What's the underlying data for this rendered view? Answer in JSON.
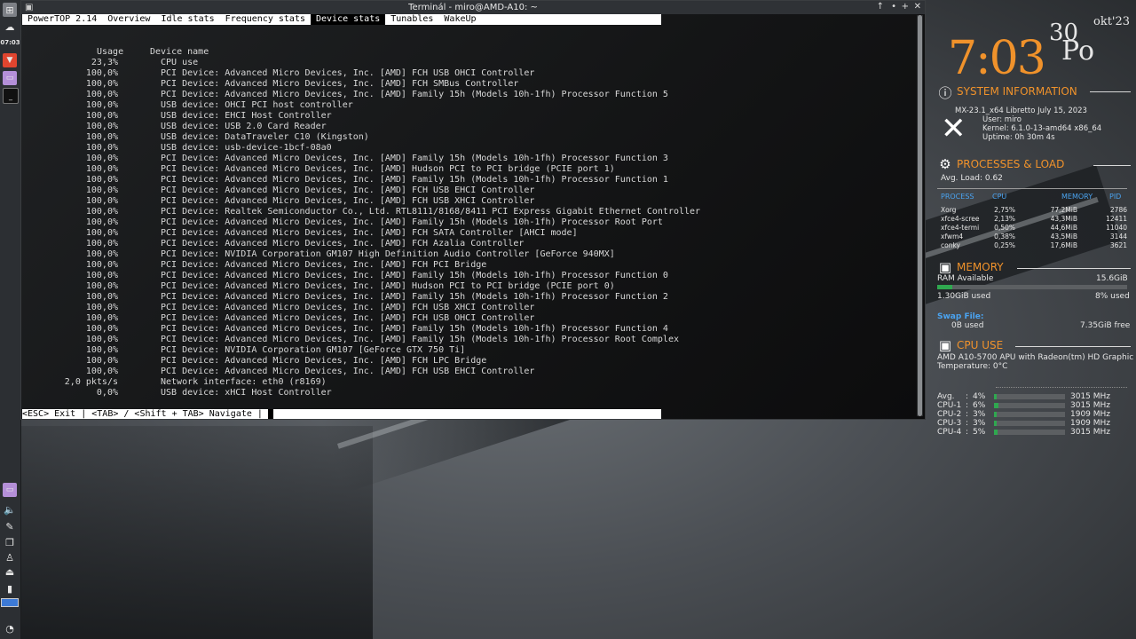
{
  "panel": {
    "clock": "07:03"
  },
  "window": {
    "title": "Terminál - miro@AMD-A10: ~"
  },
  "powertop": {
    "tabs": [
      {
        "label": "PowerTOP 2.14",
        "selected": false
      },
      {
        "label": "Overview",
        "selected": false
      },
      {
        "label": "Idle stats",
        "selected": false
      },
      {
        "label": "Frequency stats",
        "selected": false
      },
      {
        "label": "Device stats",
        "selected": true
      },
      {
        "label": "Tunables",
        "selected": false
      },
      {
        "label": "WakeUp",
        "selected": false
      }
    ],
    "header_usage": "Usage",
    "header_device": "Device name",
    "rows": [
      {
        "usage": "23,3%",
        "device": "CPU use"
      },
      {
        "usage": "100,0%",
        "device": "PCI Device: Advanced Micro Devices, Inc. [AMD] FCH USB OHCI Controller"
      },
      {
        "usage": "100,0%",
        "device": "PCI Device: Advanced Micro Devices, Inc. [AMD] FCH SMBus Controller"
      },
      {
        "usage": "100,0%",
        "device": "PCI Device: Advanced Micro Devices, Inc. [AMD] Family 15h (Models 10h-1fh) Processor Function 5"
      },
      {
        "usage": "100,0%",
        "device": "USB device: OHCI PCI host controller"
      },
      {
        "usage": "100,0%",
        "device": "USB device: EHCI Host Controller"
      },
      {
        "usage": "100,0%",
        "device": "USB device: USB 2.0 Card Reader"
      },
      {
        "usage": "100,0%",
        "device": "USB device: DataTraveler C10 (Kingston)"
      },
      {
        "usage": "100,0%",
        "device": "USB device: usb-device-1bcf-08a0"
      },
      {
        "usage": "100,0%",
        "device": "PCI Device: Advanced Micro Devices, Inc. [AMD] Family 15h (Models 10h-1fh) Processor Function 3"
      },
      {
        "usage": "100,0%",
        "device": "PCI Device: Advanced Micro Devices, Inc. [AMD] Hudson PCI to PCI bridge (PCIE port 1)"
      },
      {
        "usage": "100,0%",
        "device": "PCI Device: Advanced Micro Devices, Inc. [AMD] Family 15h (Models 10h-1fh) Processor Function 1"
      },
      {
        "usage": "100,0%",
        "device": "PCI Device: Advanced Micro Devices, Inc. [AMD] FCH USB EHCI Controller"
      },
      {
        "usage": "100,0%",
        "device": "PCI Device: Advanced Micro Devices, Inc. [AMD] FCH USB XHCI Controller"
      },
      {
        "usage": "100,0%",
        "device": "PCI Device: Realtek Semiconductor Co., Ltd. RTL8111/8168/8411 PCI Express Gigabit Ethernet Controller"
      },
      {
        "usage": "100,0%",
        "device": "PCI Device: Advanced Micro Devices, Inc. [AMD] Family 15h (Models 10h-1fh) Processor Root Port"
      },
      {
        "usage": "100,0%",
        "device": "PCI Device: Advanced Micro Devices, Inc. [AMD] FCH SATA Controller [AHCI mode]"
      },
      {
        "usage": "100,0%",
        "device": "PCI Device: Advanced Micro Devices, Inc. [AMD] FCH Azalia Controller"
      },
      {
        "usage": "100,0%",
        "device": "PCI Device: NVIDIA Corporation GM107 High Definition Audio Controller [GeForce 940MX]"
      },
      {
        "usage": "100,0%",
        "device": "PCI Device: Advanced Micro Devices, Inc. [AMD] FCH PCI Bridge"
      },
      {
        "usage": "100,0%",
        "device": "PCI Device: Advanced Micro Devices, Inc. [AMD] Family 15h (Models 10h-1fh) Processor Function 0"
      },
      {
        "usage": "100,0%",
        "device": "PCI Device: Advanced Micro Devices, Inc. [AMD] Hudson PCI to PCI bridge (PCIE port 0)"
      },
      {
        "usage": "100,0%",
        "device": "PCI Device: Advanced Micro Devices, Inc. [AMD] Family 15h (Models 10h-1fh) Processor Function 2"
      },
      {
        "usage": "100,0%",
        "device": "PCI Device: Advanced Micro Devices, Inc. [AMD] FCH USB XHCI Controller"
      },
      {
        "usage": "100,0%",
        "device": "PCI Device: Advanced Micro Devices, Inc. [AMD] FCH USB OHCI Controller"
      },
      {
        "usage": "100,0%",
        "device": "PCI Device: Advanced Micro Devices, Inc. [AMD] Family 15h (Models 10h-1fh) Processor Function 4"
      },
      {
        "usage": "100,0%",
        "device": "PCI Device: Advanced Micro Devices, Inc. [AMD] Family 15h (Models 10h-1fh) Processor Root Complex"
      },
      {
        "usage": "100,0%",
        "device": "PCI Device: NVIDIA Corporation GM107 [GeForce GTX 750 Ti]"
      },
      {
        "usage": "100,0%",
        "device": "PCI Device: Advanced Micro Devices, Inc. [AMD] FCH LPC Bridge"
      },
      {
        "usage": "100,0%",
        "device": "PCI Device: Advanced Micro Devices, Inc. [AMD] FCH USB EHCI Controller"
      },
      {
        "usage": "2,0 pkts/s",
        "device": "Network interface: eth0 (r8169)"
      },
      {
        "usage": "0,0%",
        "device": "USB device: xHCI Host Controller"
      }
    ],
    "footer_hint": "<ESC> Exit | <TAB> / <Shift + TAB> Navigate | "
  },
  "conky": {
    "time": "7:03",
    "day": "30",
    "month": "okt'23",
    "weekday": "Po",
    "accent_color": "#f0922b",
    "sysinfo": {
      "heading": "SYSTEM INFORMATION",
      "distro": "MX-23.1_x64 Libretto July 15, 2023",
      "user": "User: miro",
      "kernel": "Kernel: 6.1.0-13-amd64 x86_64",
      "uptime": "Uptime: 0h 30m 4s"
    },
    "processes": {
      "heading": "PROCESSES & LOAD",
      "avg_load": "Avg. Load: 0.62",
      "columns": [
        "PROCESS",
        "CPU",
        "MEMORY",
        "PID"
      ],
      "list": [
        {
          "name": "Xorg",
          "cpu": "2,75%",
          "mem": "77,2MiB",
          "pid": "2786"
        },
        {
          "name": "xfce4-scree",
          "cpu": "2,13%",
          "mem": "43,3MiB",
          "pid": "12411"
        },
        {
          "name": "xfce4-termi",
          "cpu": "0,50%",
          "mem": "44,6MiB",
          "pid": "11040"
        },
        {
          "name": "xfwm4",
          "cpu": "0,38%",
          "mem": "43,5MiB",
          "pid": "3144"
        },
        {
          "name": "conky",
          "cpu": "0,25%",
          "mem": "17,6MiB",
          "pid": "3621"
        }
      ]
    },
    "memory": {
      "heading": "MEMORY",
      "ram_label": "RAM Available",
      "ram_total": "15.6GiB",
      "used": "1.30GiB used",
      "used_pct": "8% used",
      "used_fraction": 0.08,
      "swap_label": "Swap File:",
      "swap_used": "0B used",
      "swap_free": "7.35GiB free"
    },
    "cpu": {
      "heading": "CPU USE",
      "model": "AMD A10-5700 APU with Radeon(tm) HD Graphic",
      "temperature": "Temperature:  0°C",
      "cores": [
        {
          "label": "Avg.",
          "pct": "4%",
          "value": 0.04,
          "mhz": "3015 MHz"
        },
        {
          "label": "CPU-1",
          "pct": "6%",
          "value": 0.06,
          "mhz": "3015 MHz"
        },
        {
          "label": "CPU-2",
          "pct": "3%",
          "value": 0.03,
          "mhz": "1909 MHz"
        },
        {
          "label": "CPU-3",
          "pct": "3%",
          "value": 0.03,
          "mhz": "1909 MHz"
        },
        {
          "label": "CPU-4",
          "pct": "5%",
          "value": 0.05,
          "mhz": "3015 MHz"
        }
      ]
    }
  }
}
